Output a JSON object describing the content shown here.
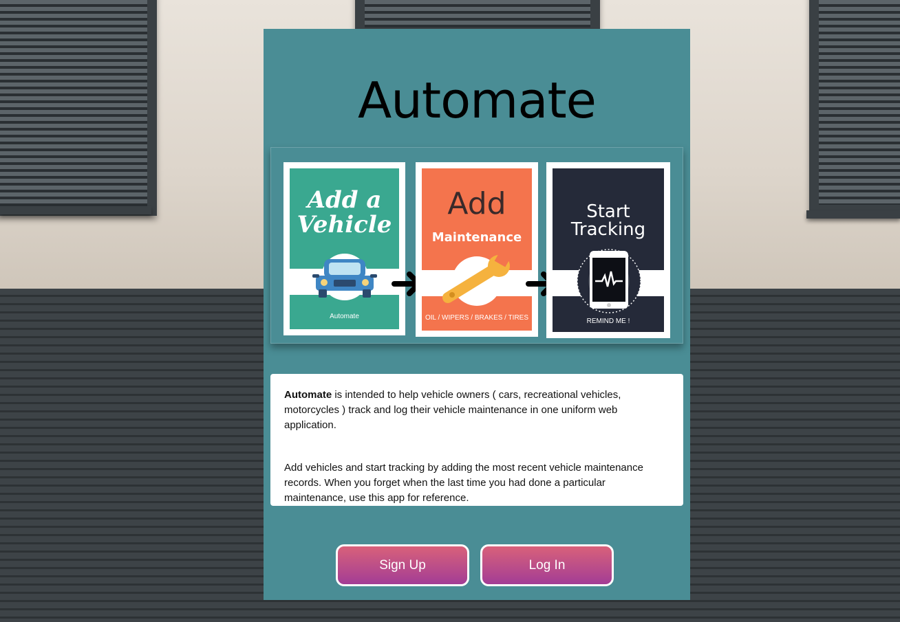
{
  "app": {
    "title": "Automate",
    "colors": {
      "card_background": "#4a8d95",
      "button_gradient_top": "#d8617a",
      "button_gradient_bottom": "#a33d95",
      "panel1_green": "#3aa890",
      "panel2_orange": "#f4744d",
      "panel3_navy": "#252a39"
    }
  },
  "hero": {
    "steps": [
      {
        "title_line1": "Add a",
        "title_line2": "Vehicle",
        "caption": "Automate",
        "icon": "car-icon"
      },
      {
        "title_line1": "Add",
        "title_line2": "Maintenance",
        "caption": "OIL / WIPERS / BRAKES / TIRES",
        "icon": "wrench-icon"
      },
      {
        "title_line1": "Start",
        "title_line2": "Tracking",
        "caption": "REMIND ME !",
        "icon": "phone-heartbeat-icon"
      }
    ],
    "arrow_icon": "arrow-right-icon"
  },
  "description": {
    "brand": "Automate",
    "para1_rest": " is intended to help vehicle owners ( cars, recreational vehicles, motorcycles ) track and log their vehicle maintenance in one uniform web application.",
    "para2": "Add vehicles and start tracking by adding the most recent vehicle maintenance records. When you forget when the last time you had done a particular maintenance, use this app for reference."
  },
  "actions": {
    "signup_label": "Sign Up",
    "login_label": "Log In"
  }
}
